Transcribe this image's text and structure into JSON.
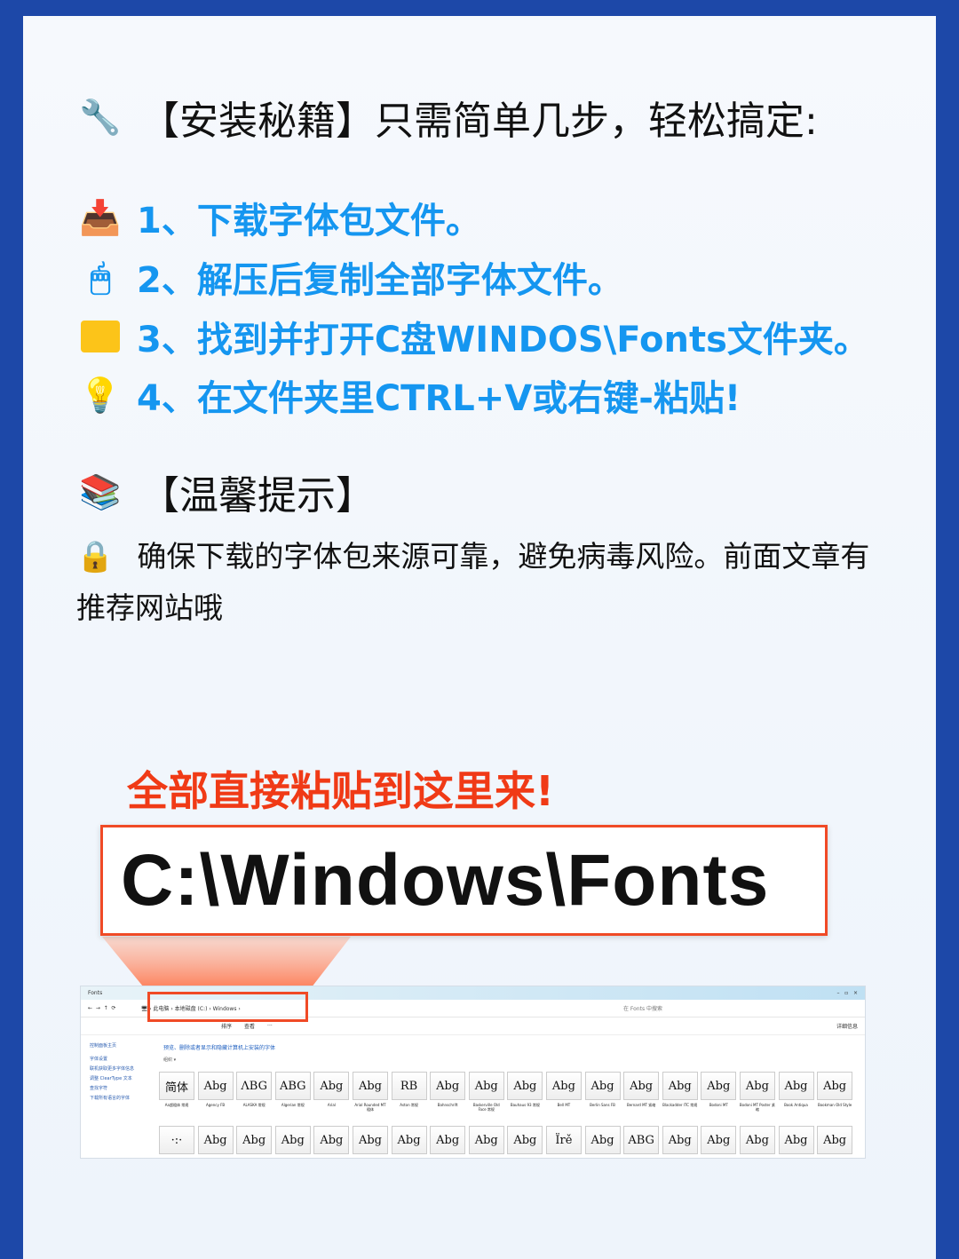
{
  "title": {
    "icon": "wrench-icon",
    "text": "【安装秘籍】只需简单几步，轻松搞定:"
  },
  "steps": [
    {
      "icon": "inbox-download-icon",
      "text": "1、下载字体包文件。"
    },
    {
      "icon": "mouse-icon",
      "text": "2、解压后复制全部字体文件。"
    },
    {
      "icon": "folder-icon",
      "text": "3、找到并打开C盘WINDOS\\Fonts文件夹。"
    },
    {
      "icon": "lightbulb-icon",
      "text": "4、在文件夹里CTRL+V或右键-粘贴!"
    }
  ],
  "tips": {
    "icon": "books-icon",
    "heading": "【温馨提示】",
    "lock_icon": "lock-icon",
    "text": "确保下载的字体包来源可靠，避免病毒风险。前面文章有推荐网站哦"
  },
  "callout": "全部直接粘贴到这里来!",
  "path": "C:\\Windows\\Fonts",
  "colors": {
    "accent": "#1596f0",
    "callout": "#f03a16",
    "frame": "#1d48a8"
  },
  "explorer": {
    "tab": "Fonts",
    "breadcrumb": [
      "此电脑",
      "本地磁盘 (C:)",
      "Windows"
    ],
    "search_placeholder": "在 Fonts 中搜索",
    "sort": "排序",
    "view": "查看",
    "more": "···",
    "details": "详细信息",
    "sidebar": [
      "控制面板主页",
      "字体设置",
      "联机获取更多字体信息",
      "调整 ClearType 文本",
      "查找字符",
      "下载所有语言的字体"
    ],
    "heading": "预览、删除或者显示和隐藏计算机上安装的字体",
    "group": "组织 ▾",
    "fonts": [
      {
        "p": "简体",
        "n": "Aa超粗体 常规"
      },
      {
        "p": "Abg",
        "n": "Agency FB"
      },
      {
        "p": "ΛBG",
        "n": "ALASKA 常规"
      },
      {
        "p": "ABG",
        "n": "Algerian 常规"
      },
      {
        "p": "Abg",
        "n": "Arial"
      },
      {
        "p": "Abg",
        "n": "Arial Rounded MT 粗体"
      },
      {
        "p": "RB",
        "n": "Aston 常规"
      },
      {
        "p": "Abg",
        "n": "Bahnschrift"
      },
      {
        "p": "Abg",
        "n": "Baskerville Old Face 常规"
      },
      {
        "p": "Abg",
        "n": "Bauhaus 93 常规"
      },
      {
        "p": "Abg",
        "n": "Bell MT"
      },
      {
        "p": "Abg",
        "n": "Berlin Sans FB"
      },
      {
        "p": "Abg",
        "n": "Bernard MT 紧缩"
      },
      {
        "p": "Abg",
        "n": "Blackadder ITC 常规"
      },
      {
        "p": "Abg",
        "n": "Bodoni MT"
      },
      {
        "p": "Abg",
        "n": "Bodoni MT Poster 紧缩"
      },
      {
        "p": "Abg",
        "n": "Book Antiqua"
      },
      {
        "p": "Abg",
        "n": "Bookman Old Style"
      },
      {
        "p": "·:·",
        "n": ""
      },
      {
        "p": "Abg",
        "n": ""
      },
      {
        "p": "Abg",
        "n": ""
      },
      {
        "p": "Abg",
        "n": ""
      },
      {
        "p": "Abg",
        "n": ""
      },
      {
        "p": "Abg",
        "n": ""
      },
      {
        "p": "Abg",
        "n": ""
      },
      {
        "p": "Abg",
        "n": ""
      },
      {
        "p": "Abg",
        "n": ""
      },
      {
        "p": "Abg",
        "n": ""
      },
      {
        "p": "Ïrě",
        "n": ""
      },
      {
        "p": "Abg",
        "n": ""
      },
      {
        "p": "ABG",
        "n": ""
      },
      {
        "p": "Abg",
        "n": ""
      },
      {
        "p": "Abg",
        "n": ""
      },
      {
        "p": "Abg",
        "n": ""
      },
      {
        "p": "Abg",
        "n": ""
      },
      {
        "p": "Abg",
        "n": ""
      }
    ]
  }
}
